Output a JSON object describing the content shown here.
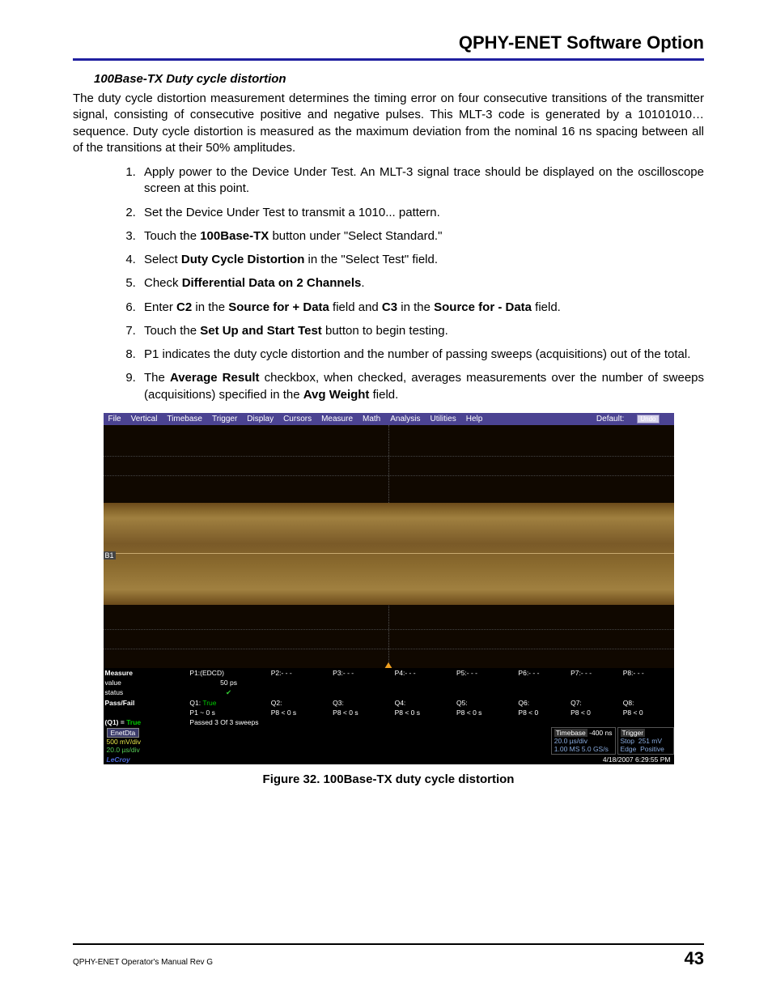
{
  "header": {
    "title": "QPHY-ENET Software Option"
  },
  "section": {
    "heading": "100Base-TX Duty cycle distortion"
  },
  "intro": "The duty cycle distortion measurement determines the timing error on four consecutive transitions of the transmitter signal, consisting of consecutive positive and negative pulses. This MLT-3 code is generated by a 10101010… sequence. Duty cycle distortion is measured as the maximum deviation from the nominal 16 ns spacing between all of the transitions at their 50% amplitudes.",
  "steps": {
    "s1": "Apply power to the Device Under Test. An MLT-3 signal trace should be displayed on the oscilloscope screen at this point.",
    "s2": "Set the Device Under Test to transmit a 1010... pattern.",
    "s3a": "Touch the ",
    "s3b": "100Base-TX",
    "s3c": " button under \"Select Standard.\"",
    "s4a": "Select ",
    "s4b": "Duty Cycle Distortion",
    "s4c": " in the \"Select Test\" field.",
    "s5a": "Check ",
    "s5b": "Differential Data on 2 Channels",
    "s5c": ".",
    "s6a": "Enter ",
    "s6b": "C2",
    "s6c": " in the ",
    "s6d": "Source for + Data",
    "s6e": " field and ",
    "s6f": "C3",
    "s6g": " in the ",
    "s6h": "Source for - Data",
    "s6i": " field.",
    "s7a": "Touch the ",
    "s7b": "Set Up and Start Test",
    "s7c": " button to begin testing.",
    "s8": "P1 indicates the duty cycle distortion and the number of passing sweeps (acquisitions) out of the total.",
    "s9a": "The ",
    "s9b": "Average Result",
    "s9c": " checkbox, when checked, averages measurements over the number of sweeps (acquisitions) specified in the ",
    "s9d": "Avg Weight",
    "s9e": " field."
  },
  "scope": {
    "menu": {
      "m0": "File",
      "m1": "Vertical",
      "m2": "Timebase",
      "m3": "Trigger",
      "m4": "Display",
      "m5": "Cursors",
      "m6": "Measure",
      "m7": "Math",
      "m8": "Analysis",
      "m9": "Utilities",
      "m10": "Help",
      "default": "Default:",
      "undo": "Undo"
    },
    "b1": "B1",
    "measure": {
      "row": "Measure",
      "p1": "P1:(EDCD)",
      "p2": "P2:- - -",
      "p3": "P3:- - -",
      "p4": "P4:- - -",
      "p5": "P5:- - -",
      "p6": "P6:- - -",
      "p7": "P7:- - -",
      "p8": "P8:- - -",
      "value_lbl": "value",
      "value": "50 ps",
      "status_lbl": "status",
      "check": "✔"
    },
    "passfail": {
      "lbl": "Pass/Fail",
      "q1": "Q1:",
      "q1v": "True",
      "q2": "Q2:",
      "q3": "Q3:",
      "q4": "Q4:",
      "q5": "Q5:",
      "q6": "Q6:",
      "q7": "Q7:",
      "q8": "Q8:",
      "p1": "P1 ~ 0 s",
      "p8a": "P8 < 0 s",
      "p8b": "P8 < 0 s",
      "p8c": "P8 < 0 s",
      "p8d": "P8 < 0 s",
      "p8e": "P8 < 0",
      "p8f": "P8 < 0",
      "p8g": "P8 < 0",
      "q1eq": "(Q1) = ",
      "q1eqv": "True",
      "passed": "Passed 3  Of 3  sweeps"
    },
    "enet": {
      "lbl": "EnetDta",
      "v": "500 mV/div",
      "t": "20.0 µs/div"
    },
    "timebase": {
      "lbl": "Timebase",
      "off": "-400 ns",
      "div": "20.0 µs/div",
      "rec": "1.00 MS   5.0 GS/s"
    },
    "trigger": {
      "lbl": "Trigger",
      "stop": "Stop",
      "lvl": "251 mV",
      "edge": "Edge",
      "pos": "Positive"
    },
    "brand": "LeCroy",
    "ts": "4/18/2007 6:29:55 PM"
  },
  "caption": "Figure 32. 100Base-TX duty cycle distortion",
  "footer": {
    "doc": "QPHY-ENET Operator's Manual Rev G",
    "page": "43"
  }
}
